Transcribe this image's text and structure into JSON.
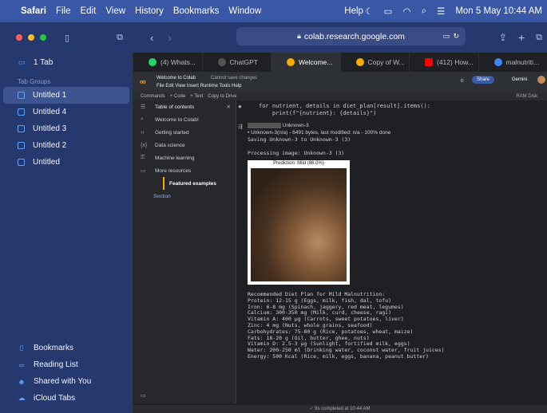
{
  "menubar": {
    "app": "Safari",
    "items": [
      "File",
      "Edit",
      "View",
      "History",
      "Bookmarks",
      "Window",
      "Help"
    ],
    "clock": "Mon 5 May  10:44 AM"
  },
  "sidebar": {
    "tab_count": "1 Tab",
    "groups_header": "Tab Groups",
    "groups": [
      "Untitled 1",
      "Untitled 4",
      "Untitled 3",
      "Untitled 2",
      "Untitled"
    ],
    "bottom": [
      "Bookmarks",
      "Reading List",
      "Shared with You",
      "iCloud Tabs"
    ]
  },
  "toolbar": {
    "url": "colab.research.google.com"
  },
  "tabs": [
    {
      "label": "(4) Whats...",
      "color": "#25d366"
    },
    {
      "label": "ChatGPT",
      "color": "#444"
    },
    {
      "label": "Welcome...",
      "color": "#f9ab00"
    },
    {
      "label": "Copy of W...",
      "color": "#f9ab00"
    },
    {
      "label": "(412) How...",
      "color": "#ff0000"
    },
    {
      "label": "malnutriti...",
      "color": "#4285f4"
    }
  ],
  "colab": {
    "title": "Welcome to Colab",
    "save_note": "Cannot save changes",
    "menus": "File  Edit  View  Insert  Runtime  Tools  Help",
    "commands": "Commands",
    "code": "+ Code",
    "text": "+ Text",
    "copy": "Copy to Drive",
    "share": "Share",
    "gemini": "Gemini",
    "ram": "RAM",
    "disk": "Disk"
  },
  "toc": {
    "header": "Table of contents",
    "items": [
      "Welcome to Colab!",
      "Getting started",
      "Data science",
      "Machine learning",
      "More resources",
      "Featured examples",
      "Section"
    ]
  },
  "code": {
    "line1": "for nutrient, details in diet_plan[result].items():",
    "line2": "    print(f\"{nutrient}: {details}\")"
  },
  "output": {
    "file_label": "Unknown-3",
    "upload_line": "• Unknown-3(n/a) - 6491 bytes, last modified: n/a - 100% done",
    "saving": "Saving Unknown-3 to Unknown-3 (3)",
    "processing": "Processing image: Unknown-3 (3)",
    "prediction": "Prediction: Mild (86.0%)",
    "plan": [
      "Recommended Diet Plan for Mild Malnutrition:",
      "Protein: 12-15 g (Eggs, milk, fish, dal, tofu)",
      "Iron: 6-8 mg (Spinach, jaggery, red meat, legumes)",
      "Calcium: 300-350 mg (Milk, curd, cheese, ragi)",
      "Vitamin A: 400 µg (Carrots, sweet potatoes, liver)",
      "Zinc: 4 mg (Nuts, whole grains, seafood)",
      "Carbohydrates: 75-80 g (Rice, potatoes, wheat, maize)",
      "Fats: 18-20 g (Oil, butter, ghee, nuts)",
      "Vitamin D: 2.5-3 µg (Sunlight, fortified milk, eggs)",
      "Water: 200-250 ml (Drinking water, coconut water, fruit juices)",
      "Energy: 500 Kcal (Rice, milk, eggs, banana, peanut butter)"
    ]
  },
  "status": "✓ 9s   completed at 10:44 AM"
}
